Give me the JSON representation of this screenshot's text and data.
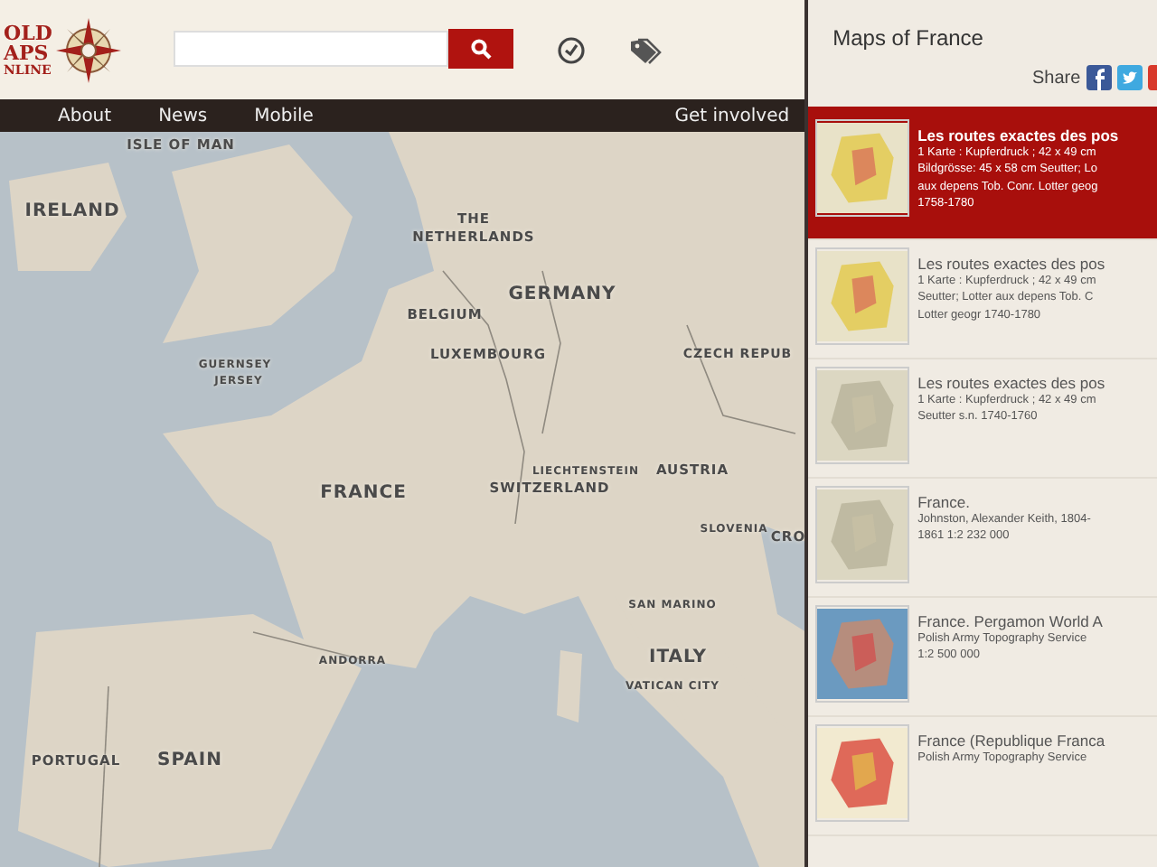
{
  "logo": {
    "lines": [
      "OLD",
      "APS",
      "NLINE"
    ]
  },
  "nav": {
    "items": [
      {
        "label": "About"
      },
      {
        "label": "News"
      },
      {
        "label": "Mobile"
      }
    ],
    "right": "Get involved"
  },
  "map": {
    "labels": [
      {
        "text": "ISLE OF MAN",
        "kind": "minor"
      },
      {
        "text": "IRELAND",
        "kind": "country"
      },
      {
        "text": "THE",
        "kind": "minor"
      },
      {
        "text": "NETHERLANDS",
        "kind": "minor"
      },
      {
        "text": "GERMANY",
        "kind": "country"
      },
      {
        "text": "BELGIUM",
        "kind": "minor"
      },
      {
        "text": "LUXEMBOURG",
        "kind": "minor"
      },
      {
        "text": "CZECH REPUB",
        "kind": "minor"
      },
      {
        "text": "GUERNSEY",
        "kind": "tiny"
      },
      {
        "text": "JERSEY",
        "kind": "tiny"
      },
      {
        "text": "LIECHTENSTEIN",
        "kind": "tiny"
      },
      {
        "text": "AUSTRIA",
        "kind": "minor"
      },
      {
        "text": "FRANCE",
        "kind": "country"
      },
      {
        "text": "SWITZERLAND",
        "kind": "minor"
      },
      {
        "text": "SLOVENIA",
        "kind": "tiny"
      },
      {
        "text": "CRO",
        "kind": "minor"
      },
      {
        "text": "SAN MARINO",
        "kind": "tiny"
      },
      {
        "text": "ITALY",
        "kind": "country"
      },
      {
        "text": "VATICAN CITY",
        "kind": "tiny"
      },
      {
        "text": "ANDORRA",
        "kind": "tiny"
      },
      {
        "text": "PORTUGAL",
        "kind": "minor"
      },
      {
        "text": "SPAIN",
        "kind": "country"
      }
    ]
  },
  "sidebar": {
    "title": "Maps of France",
    "share_label": "Share",
    "results": [
      {
        "title": "Les routes exactes des pos",
        "lines": [
          "1 Karte : Kupferdruck ; 42 x 49 cm",
          "Bildgrösse: 45 x 58 cm Seutter; Lo",
          "aux depens Tob. Conr. Lotter geog",
          "1758-1780"
        ],
        "selected": true,
        "kind": "color"
      },
      {
        "title": "Les routes exactes des pos",
        "lines": [
          "1 Karte : Kupferdruck ; 42 x 49 cm",
          "Seutter; Lotter aux depens Tob. C",
          "Lotter geogr 1740-1780"
        ],
        "selected": false,
        "kind": "color"
      },
      {
        "title": "Les routes exactes des pos",
        "lines": [
          "1 Karte : Kupferdruck ; 42 x 49 cm",
          "Seutter s.n. 1740-1760"
        ],
        "selected": false,
        "kind": "pale"
      },
      {
        "title": "France.",
        "lines": [
          "Johnston, Alexander Keith, 1804-",
          "1861 1:2 232 000"
        ],
        "selected": false,
        "kind": "pale"
      },
      {
        "title": "France. Pergamon World A",
        "lines": [
          "Polish Army Topography Service",
          "1:2 500 000"
        ],
        "selected": false,
        "kind": "relief"
      },
      {
        "title": "France (Republique Franca",
        "lines": [
          "Polish Army Topography Service"
        ],
        "selected": false,
        "kind": "poster"
      }
    ]
  }
}
